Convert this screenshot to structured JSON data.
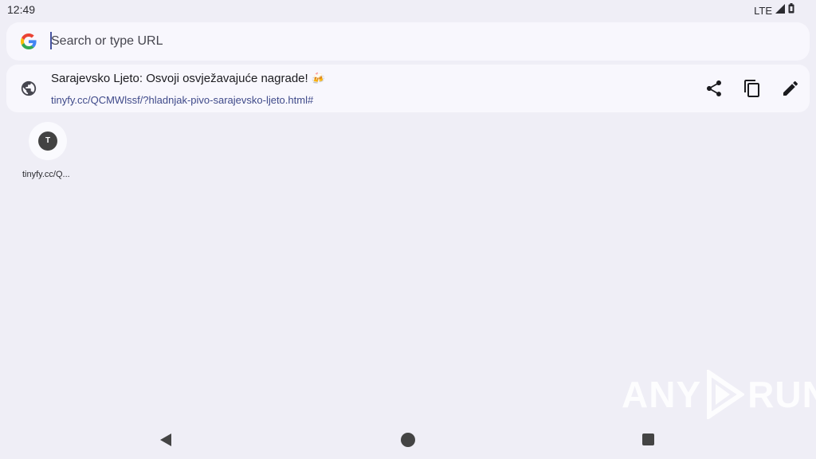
{
  "status_bar": {
    "time": "12:49",
    "network": "LTE",
    "icons": [
      "signal-icon",
      "battery-icon"
    ]
  },
  "omnibox": {
    "placeholder": "Search or type URL",
    "value": "",
    "icon": "google-icon"
  },
  "suggestion": {
    "title": "Sarajevsko Ljeto: Osvoji osvježavajuće nagrade!",
    "emoji": "🍻",
    "url": "tinyfy.cc/QCMWlssf/?hladnjak-pivo-sarajevsko-ljeto.html#",
    "actions": [
      "share-icon",
      "copy-icon",
      "edit-icon"
    ]
  },
  "tiles": [
    {
      "letter": "T",
      "label": "tinyfy.cc/Q..."
    }
  ],
  "watermark": {
    "left": "ANY",
    "right": "RUN"
  },
  "navigation": {
    "icons": [
      "back-icon",
      "home-icon",
      "recents-icon"
    ]
  },
  "colors": {
    "background": "#efeef6",
    "card": "#f8f7fd",
    "url_text": "#3f4a8a",
    "caret": "#4653a0"
  }
}
